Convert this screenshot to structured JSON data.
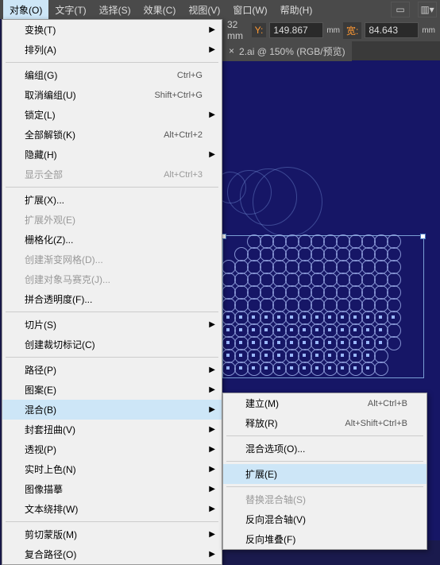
{
  "menubar": {
    "items": [
      "对象(O)",
      "文字(T)",
      "选择(S)",
      "效果(C)",
      "视图(V)",
      "窗口(W)",
      "帮助(H)"
    ]
  },
  "coords": {
    "x_suffix": "32 mm",
    "y_label": "Y:",
    "y_value": "149.867",
    "w_label": "宽:",
    "w_value": "84.643",
    "unit": "mm"
  },
  "tab": {
    "title": "2.ai @ 150% (RGB/预览)",
    "close": "×"
  },
  "dropdown": {
    "groups": [
      [
        {
          "label": "变换(T)",
          "arrow": true
        },
        {
          "label": "排列(A)",
          "arrow": true
        }
      ],
      [
        {
          "label": "编组(G)",
          "shortcut": "Ctrl+G"
        },
        {
          "label": "取消编组(U)",
          "shortcut": "Shift+Ctrl+G"
        },
        {
          "label": "锁定(L)",
          "arrow": true
        },
        {
          "label": "全部解锁(K)",
          "shortcut": "Alt+Ctrl+2"
        },
        {
          "label": "隐藏(H)",
          "arrow": true
        },
        {
          "label": "显示全部",
          "shortcut": "Alt+Ctrl+3",
          "disabled": true
        }
      ],
      [
        {
          "label": "扩展(X)..."
        },
        {
          "label": "扩展外观(E)",
          "disabled": true
        },
        {
          "label": "栅格化(Z)..."
        },
        {
          "label": "创建渐变网格(D)...",
          "disabled": true
        },
        {
          "label": "创建对象马赛克(J)...",
          "disabled": true
        },
        {
          "label": "拼合透明度(F)..."
        }
      ],
      [
        {
          "label": "切片(S)",
          "arrow": true
        },
        {
          "label": "创建裁切标记(C)"
        }
      ],
      [
        {
          "label": "路径(P)",
          "arrow": true
        },
        {
          "label": "图案(E)",
          "arrow": true
        },
        {
          "label": "混合(B)",
          "arrow": true,
          "hover": true
        },
        {
          "label": "封套扭曲(V)",
          "arrow": true
        },
        {
          "label": "透视(P)",
          "arrow": true
        },
        {
          "label": "实时上色(N)",
          "arrow": true
        },
        {
          "label": "图像描摹",
          "arrow": true
        },
        {
          "label": "文本绕排(W)",
          "arrow": true
        }
      ],
      [
        {
          "label": "剪切蒙版(M)",
          "arrow": true
        },
        {
          "label": "复合路径(O)",
          "arrow": true
        }
      ]
    ]
  },
  "submenu": {
    "groups": [
      [
        {
          "label": "建立(M)",
          "shortcut": "Alt+Ctrl+B"
        },
        {
          "label": "释放(R)",
          "shortcut": "Alt+Shift+Ctrl+B"
        }
      ],
      [
        {
          "label": "混合选项(O)..."
        }
      ],
      [
        {
          "label": "扩展(E)",
          "hover": true
        }
      ],
      [
        {
          "label": "替换混合轴(S)",
          "disabled": true
        },
        {
          "label": "反向混合轴(V)"
        },
        {
          "label": "反向堆叠(F)"
        }
      ]
    ]
  }
}
